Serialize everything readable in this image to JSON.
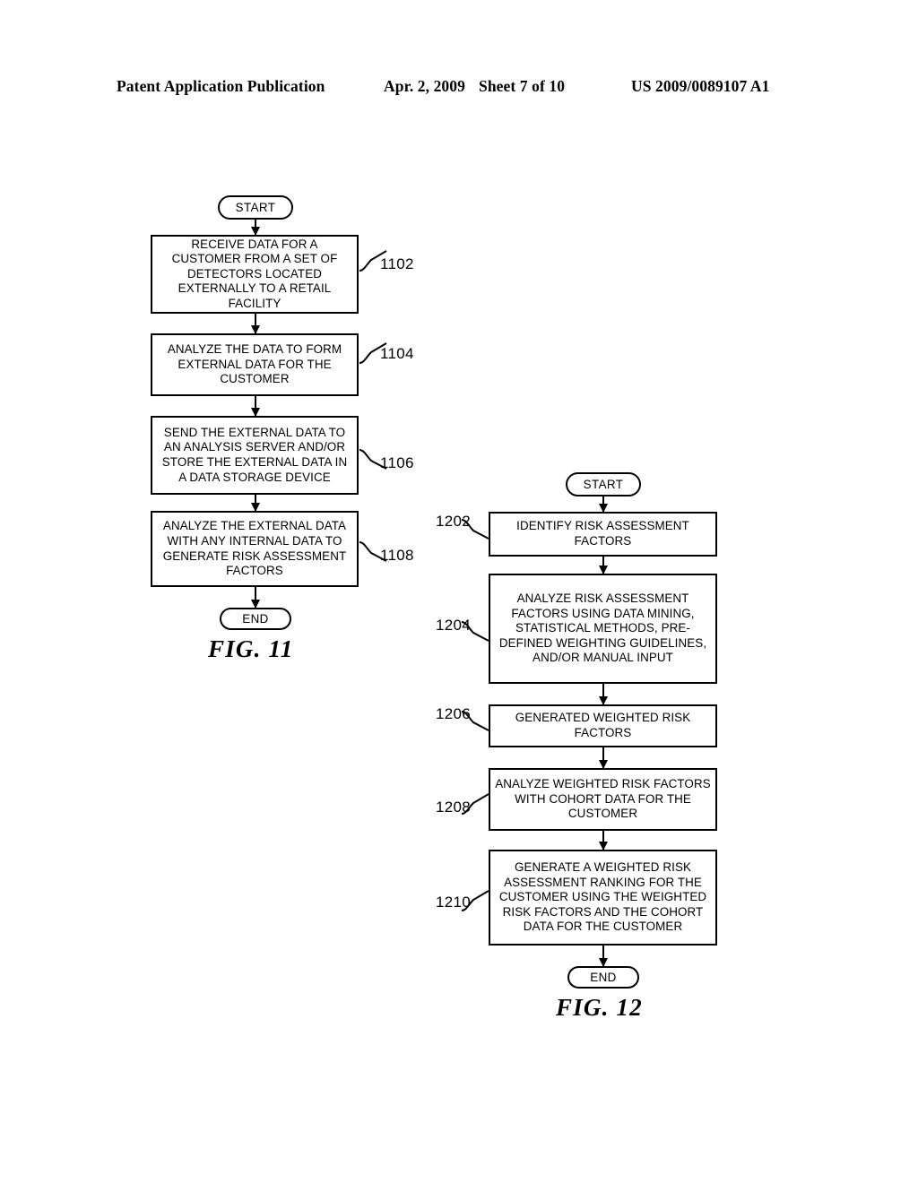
{
  "header": {
    "publication": "Patent Application Publication",
    "date": "Apr. 2, 2009",
    "sheet": "Sheet 7 of 10",
    "patent_number": "US 2009/0089107 A1"
  },
  "figures": [
    {
      "caption": "FIG. 11",
      "start_label": "START",
      "end_label": "END",
      "steps": [
        {
          "ref": "1102",
          "text": "RECEIVE DATA FOR A CUSTOMER FROM A SET OF DETECTORS LOCATED EXTERNALLY TO A RETAIL FACILITY"
        },
        {
          "ref": "1104",
          "text": "ANALYZE THE DATA TO FORM EXTERNAL DATA FOR THE CUSTOMER"
        },
        {
          "ref": "1106",
          "text": "SEND THE EXTERNAL DATA TO AN ANALYSIS SERVER AND/OR STORE THE EXTERNAL DATA IN A DATA STORAGE DEVICE"
        },
        {
          "ref": "1108",
          "text": "ANALYZE THE EXTERNAL DATA WITH ANY INTERNAL DATA TO GENERATE RISK ASSESSMENT FACTORS"
        }
      ]
    },
    {
      "caption": "FIG. 12",
      "start_label": "START",
      "end_label": "END",
      "steps": [
        {
          "ref": "1202",
          "text": "IDENTIFY RISK ASSESSMENT FACTORS"
        },
        {
          "ref": "1204",
          "text": "ANALYZE RISK ASSESSMENT FACTORS USING DATA MINING, STATISTICAL METHODS, PRE-DEFINED WEIGHTING GUIDELINES, AND/OR MANUAL INPUT"
        },
        {
          "ref": "1206",
          "text": "GENERATED WEIGHTED RISK FACTORS"
        },
        {
          "ref": "1208",
          "text": "ANALYZE WEIGHTED RISK FACTORS WITH COHORT DATA FOR THE CUSTOMER"
        },
        {
          "ref": "1210",
          "text": "GENERATE A WEIGHTED RISK ASSESSMENT RANKING FOR THE CUSTOMER USING THE WEIGHTED RISK FACTORS AND THE COHORT DATA FOR THE CUSTOMER"
        }
      ]
    }
  ],
  "colors": {
    "ink": "#000000",
    "paper": "#ffffff"
  }
}
